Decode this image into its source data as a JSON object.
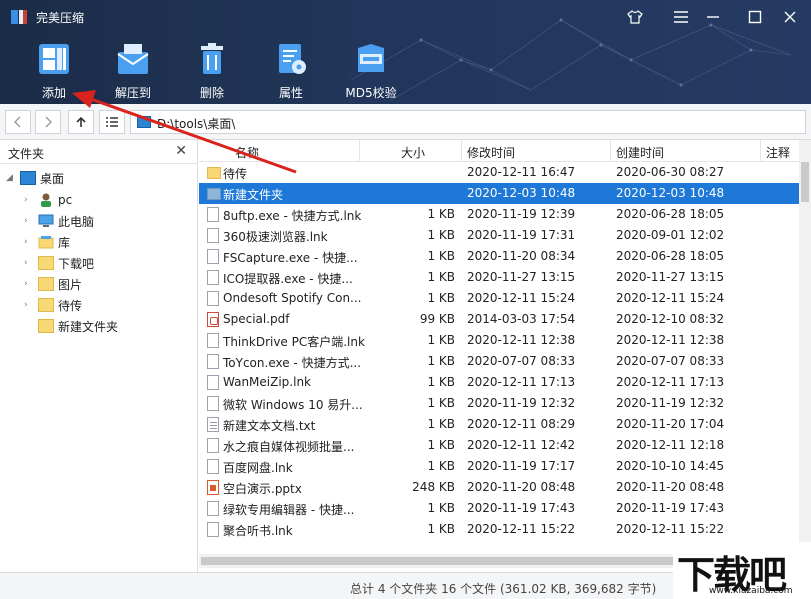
{
  "app": {
    "title": "完美压缩"
  },
  "toolbar": {
    "buttons": [
      {
        "label": "添加",
        "icon": "add-icon"
      },
      {
        "label": "解压到",
        "icon": "extract-icon"
      },
      {
        "label": "删除",
        "icon": "delete-icon"
      },
      {
        "label": "属性",
        "icon": "properties-icon"
      },
      {
        "label": "MD5校验",
        "icon": "md5-icon"
      }
    ]
  },
  "address": {
    "path": "D:\\tools\\桌面\\"
  },
  "left_pane": {
    "title": "文件夹",
    "tree": [
      {
        "label": "桌面",
        "level": 0,
        "icon": "desktop-icon"
      },
      {
        "label": "pc",
        "level": 1,
        "icon": "user-icon"
      },
      {
        "label": "此电脑",
        "level": 1,
        "icon": "computer-icon"
      },
      {
        "label": "库",
        "level": 1,
        "icon": "library-icon"
      },
      {
        "label": "下载吧",
        "level": 1,
        "icon": "folder-icon"
      },
      {
        "label": "图片",
        "level": 1,
        "icon": "folder-icon"
      },
      {
        "label": "待传",
        "level": 1,
        "icon": "folder-icon"
      },
      {
        "label": "新建文件夹",
        "level": 1,
        "icon": "folder-icon"
      }
    ]
  },
  "file_list": {
    "columns": [
      "名称",
      "大小",
      "修改时间",
      "创建时间",
      "注释"
    ],
    "rows": [
      {
        "name": "待传",
        "size": "",
        "modified": "2020-12-11 16:47",
        "created": "2020-06-30 08:27",
        "type": "folder"
      },
      {
        "name": "新建文件夹",
        "size": "",
        "modified": "2020-12-03 10:48",
        "created": "2020-12-03 10:48",
        "type": "folder",
        "selected": true
      },
      {
        "name": "8uftp.exe - 快捷方式.lnk",
        "size": "1 KB",
        "modified": "2020-11-19 12:39",
        "created": "2020-06-28 18:05",
        "type": "file"
      },
      {
        "name": "360极速浏览器.lnk",
        "size": "1 KB",
        "modified": "2020-11-19 17:31",
        "created": "2020-09-01 12:02",
        "type": "file"
      },
      {
        "name": "FSCapture.exe - 快捷...",
        "size": "1 KB",
        "modified": "2020-11-20 08:34",
        "created": "2020-06-28 18:05",
        "type": "file"
      },
      {
        "name": "ICO提取器.exe - 快捷...",
        "size": "1 KB",
        "modified": "2020-11-27 13:15",
        "created": "2020-11-27 13:15",
        "type": "file"
      },
      {
        "name": "Ondesoft Spotify Con...",
        "size": "1 KB",
        "modified": "2020-12-11 15:24",
        "created": "2020-12-11 15:24",
        "type": "file"
      },
      {
        "name": "Special.pdf",
        "size": "99 KB",
        "modified": "2014-03-03 17:54",
        "created": "2020-12-10 08:32",
        "type": "pdf"
      },
      {
        "name": "ThinkDrive PC客户端.lnk",
        "size": "1 KB",
        "modified": "2020-12-11 12:38",
        "created": "2020-12-11 12:38",
        "type": "file"
      },
      {
        "name": "ToYcon.exe - 快捷方式...",
        "size": "1 KB",
        "modified": "2020-07-07 08:33",
        "created": "2020-07-07 08:33",
        "type": "file"
      },
      {
        "name": "WanMeiZip.lnk",
        "size": "1 KB",
        "modified": "2020-12-11 17:13",
        "created": "2020-12-11 17:13",
        "type": "file"
      },
      {
        "name": "微软 Windows 10 易升...",
        "size": "1 KB",
        "modified": "2020-11-19 12:32",
        "created": "2020-11-19 12:32",
        "type": "file"
      },
      {
        "name": "新建文本文档.txt",
        "size": "1 KB",
        "modified": "2020-12-11 08:29",
        "created": "2020-11-20 17:04",
        "type": "txt"
      },
      {
        "name": "水之痕自媒体视频批量...",
        "size": "1 KB",
        "modified": "2020-12-11 12:42",
        "created": "2020-12-11 12:18",
        "type": "file"
      },
      {
        "name": "百度网盘.lnk",
        "size": "1 KB",
        "modified": "2020-11-19 17:17",
        "created": "2020-10-10 14:45",
        "type": "file"
      },
      {
        "name": "空白演示.pptx",
        "size": "248 KB",
        "modified": "2020-11-20 08:48",
        "created": "2020-11-20 08:48",
        "type": "ppt"
      },
      {
        "name": "绿软专用编辑器 - 快捷...",
        "size": "1 KB",
        "modified": "2020-11-19 17:43",
        "created": "2020-11-19 17:43",
        "type": "file"
      },
      {
        "name": "聚合听书.lnk",
        "size": "1 KB",
        "modified": "2020-12-11 15:22",
        "created": "2020-12-11 15:22",
        "type": "file"
      }
    ]
  },
  "status": {
    "text": "总计 4 个文件夹 16 个文件 (361.02 KB, 369,682 字节)"
  },
  "watermark": {
    "main": "下载吧",
    "sub": "www.xiazaiba.com"
  },
  "colors": {
    "header": "#21365a",
    "selection": "#1e78d7",
    "arrow": "#d9231c"
  }
}
